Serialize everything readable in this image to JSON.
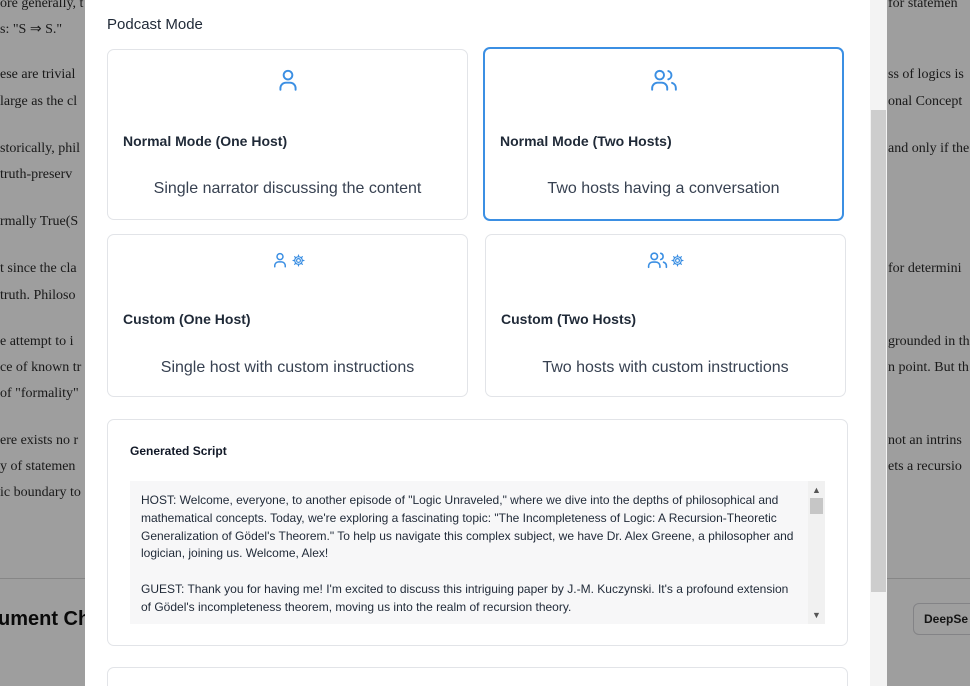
{
  "background": {
    "left_lines": [
      "ore generally, t",
      "s: \"S ⇒ S.\"",
      "ese are trivial",
      " large as the cl",
      "storically, phil",
      " truth-preserv",
      "rmally True(S",
      "t since the cla",
      "truth. Philoso",
      "e attempt to i",
      "ce of known tr",
      " of \"formality\"",
      "ere exists no r",
      "y of statemen",
      "ic boundary to"
    ],
    "right_lines": [
      "for statemen",
      "ss of logics is",
      "onal Concept",
      "and only if the",
      "for determini",
      "grounded in th",
      "n point. But th",
      "not an intrins",
      "ets a recursio"
    ],
    "heading_fragment": "ument Ch",
    "button_fragment": "DeepSe"
  },
  "podcast": {
    "section_title": "Podcast Mode",
    "modes": [
      {
        "title": "Normal Mode (One Host)",
        "description": "Single narrator discussing the content",
        "icon": "user-icon",
        "selected": false
      },
      {
        "title": "Normal Mode (Two Hosts)",
        "description": "Two hosts having a conversation",
        "icon": "users-icon",
        "selected": true
      },
      {
        "title": "Custom (One Host)",
        "description": "Single host with custom instructions",
        "icon": "user-gear-icon",
        "selected": false
      },
      {
        "title": "Custom (Two Hosts)",
        "description": "Two hosts with custom instructions",
        "icon": "users-gear-icon",
        "selected": false
      }
    ],
    "accent_color": "#3b8fe3"
  },
  "script": {
    "title": "Generated Script",
    "paragraphs": [
      "HOST: Welcome, everyone, to another episode of \"Logic Unraveled,\" where we dive into the depths of philosophical and mathematical concepts. Today, we're exploring a fascinating topic: \"The Incompleteness of Logic: A Recursion-Theoretic Generalization of Gödel's Theorem.\" To help us navigate this complex subject, we have Dr. Alex Greene, a philosopher and logician, joining us. Welcome, Alex!",
      "GUEST: Thank you for having me! I'm excited to discuss this intriguing paper by J.-M. Kuczynski. It's a profound extension of Gödel's incompleteness theorem, moving us into the realm of recursion theory."
    ]
  }
}
